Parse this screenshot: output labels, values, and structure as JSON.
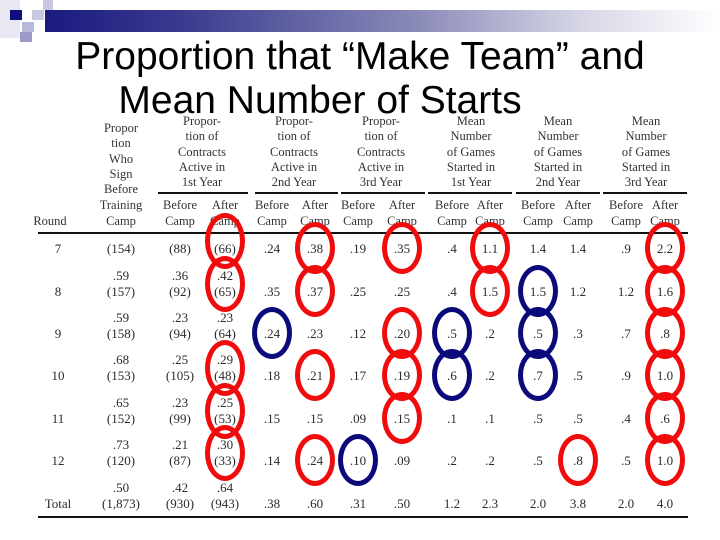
{
  "slide": {
    "title_line1": "Proportion that “Make Team” and",
    "title_line2": "Mean Number of Starts"
  },
  "colors": {
    "accent_bar": "#1a1a80",
    "red_circle": "#f00c0c",
    "blue_circle": "#0a0a7a"
  },
  "table": {
    "group_headers": [
      [
        "Propor",
        "tion",
        "Who",
        "Sign",
        "Before"
      ],
      [
        "Propor-",
        "tion of",
        "Contracts",
        "Active in",
        "1st Year"
      ],
      [
        "Propor-",
        "tion of",
        "Contracts",
        "Active in",
        "2nd Year"
      ],
      [
        "Propor-",
        "tion of",
        "Contracts",
        "Active in",
        "3rd Year"
      ],
      [
        "Mean",
        "Number",
        "of Games",
        "Started in",
        "1st Year"
      ],
      [
        "Mean",
        "Number",
        "of Games",
        "Started in",
        "2nd Year"
      ],
      [
        "Mean",
        "Number",
        "of Games",
        "Started in",
        "3rd Year"
      ]
    ],
    "sub_headers": {
      "round": "Round",
      "training_camp": [
        "Training",
        "Camp"
      ],
      "before_camp": [
        "Before",
        "Camp"
      ],
      "after_camp": [
        "After",
        "Camp"
      ]
    },
    "rows": [
      {
        "round": "7",
        "sign": [
          "",
          "(154)"
        ],
        "c1b": [
          "",
          "(88)"
        ],
        "c1a": [
          "",
          "(66)"
        ],
        "c2b": ".24",
        "c2a": ".38",
        "c3b": ".19",
        "c3a": ".35",
        "m1b": ".4",
        "m1a": "1.1",
        "m2b": "1.4",
        "m2a": "1.4",
        "m3b": ".9",
        "m3a": "2.2"
      },
      {
        "round": "8",
        "sign": [
          ".59",
          "(157)"
        ],
        "c1b": [
          ".36",
          "(92)"
        ],
        "c1a": [
          ".42",
          "(65)"
        ],
        "c2b": ".35",
        "c2a": ".37",
        "c3b": ".25",
        "c3a": ".25",
        "m1b": ".4",
        "m1a": "1.5",
        "m2b": "1.5",
        "m2a": "1.2",
        "m3b": "1.2",
        "m3a": "1.6"
      },
      {
        "round": "9",
        "sign": [
          ".59",
          "(158)"
        ],
        "c1b": [
          ".23",
          "(94)"
        ],
        "c1a": [
          ".23",
          "(64)"
        ],
        "c2b": ".24",
        "c2a": ".23",
        "c3b": ".12",
        "c3a": ".20",
        "m1b": ".5",
        "m1a": ".2",
        "m2b": ".5",
        "m2a": ".3",
        "m3b": ".7",
        "m3a": ".8"
      },
      {
        "round": "10",
        "sign": [
          ".68",
          "(153)"
        ],
        "c1b": [
          ".25",
          "(105)"
        ],
        "c1a": [
          ".29",
          "(48)"
        ],
        "c2b": ".18",
        "c2a": ".21",
        "c3b": ".17",
        "c3a": ".19",
        "m1b": ".6",
        "m1a": ".2",
        "m2b": ".7",
        "m2a": ".5",
        "m3b": ".9",
        "m3a": "1.0"
      },
      {
        "round": "11",
        "sign": [
          ".65",
          "(152)"
        ],
        "c1b": [
          ".23",
          "(99)"
        ],
        "c1a": [
          ".25",
          "(53)"
        ],
        "c2b": ".15",
        "c2a": ".15",
        "c3b": ".09",
        "c3a": ".15",
        "m1b": ".1",
        "m1a": ".1",
        "m2b": ".5",
        "m2a": ".5",
        "m3b": ".4",
        "m3a": ".6"
      },
      {
        "round": "12",
        "sign": [
          ".73",
          "(120)"
        ],
        "c1b": [
          ".21",
          "(87)"
        ],
        "c1a": [
          ".30",
          "(33)"
        ],
        "c2b": ".14",
        "c2a": ".24",
        "c3b": ".10",
        "c3a": ".09",
        "m1b": ".2",
        "m1a": ".2",
        "m2b": ".5",
        "m2a": ".8",
        "m3b": ".5",
        "m3a": "1.0"
      },
      {
        "round": "Total",
        "sign": [
          ".50",
          "(1,873)"
        ],
        "c1b": [
          ".42",
          "(930)"
        ],
        "c1a": [
          ".64",
          "(943)"
        ],
        "c2b": ".38",
        "c2a": ".60",
        "c3b": ".31",
        "c3a": ".50",
        "m1b": "1.2",
        "m1a": "2.3",
        "m2b": "2.0",
        "m2a": "3.8",
        "m3b": "2.0",
        "m3a": "4.0"
      }
    ],
    "highlights": {
      "red": [
        [
          "7",
          "c1a"
        ],
        [
          "8",
          "c1a"
        ],
        [
          "10",
          "c1a"
        ],
        [
          "11",
          "c1a"
        ],
        [
          "12",
          "c1a"
        ],
        [
          "7",
          "c2a"
        ],
        [
          "8",
          "c2a"
        ],
        [
          "10",
          "c2a"
        ],
        [
          "12",
          "c2a"
        ],
        [
          "7",
          "c3a"
        ],
        [
          "9",
          "c3a"
        ],
        [
          "10",
          "c3a"
        ],
        [
          "11",
          "c3a"
        ],
        [
          "7",
          "m1a"
        ],
        [
          "8",
          "m1a"
        ],
        [
          "12",
          "m2a"
        ],
        [
          "7",
          "m3a"
        ],
        [
          "8",
          "m3a"
        ],
        [
          "9",
          "m3a"
        ],
        [
          "10",
          "m3a"
        ],
        [
          "11",
          "m3a"
        ],
        [
          "12",
          "m3a"
        ]
      ],
      "blue": [
        [
          "9",
          "c2b"
        ],
        [
          "12",
          "c3b"
        ],
        [
          "9",
          "m1b"
        ],
        [
          "10",
          "m1b"
        ],
        [
          "8",
          "m2b"
        ],
        [
          "9",
          "m2b"
        ],
        [
          "10",
          "m2b"
        ]
      ]
    }
  }
}
